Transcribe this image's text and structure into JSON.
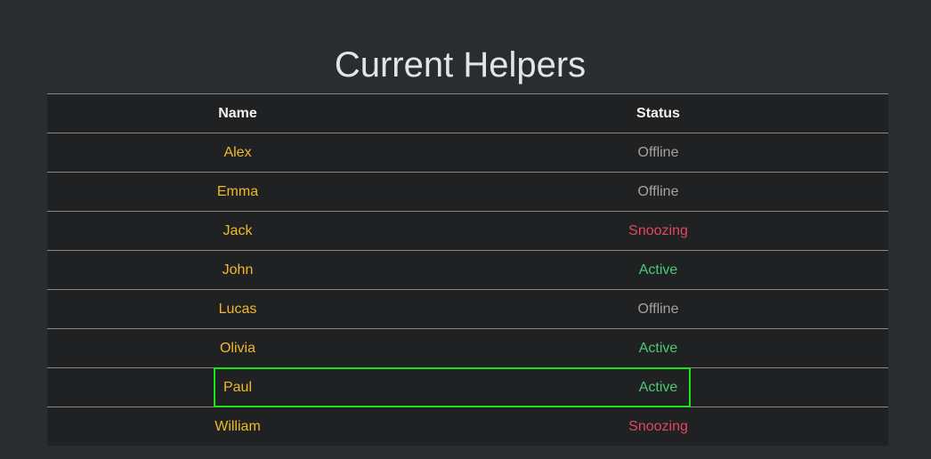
{
  "page": {
    "title": "Current Helpers"
  },
  "table": {
    "headers": {
      "name": "Name",
      "status": "Status"
    },
    "rows": [
      {
        "name": "Alex",
        "status": "Offline",
        "state": "offline"
      },
      {
        "name": "Emma",
        "status": "Offline",
        "state": "offline"
      },
      {
        "name": "Jack",
        "status": "Snoozing",
        "state": "snoozing"
      },
      {
        "name": "John",
        "status": "Active",
        "state": "active"
      },
      {
        "name": "Lucas",
        "status": "Offline",
        "state": "offline"
      },
      {
        "name": "Olivia",
        "status": "Active",
        "state": "active"
      },
      {
        "name": "Paul",
        "status": "Active",
        "state": "active"
      },
      {
        "name": "William",
        "status": "Snoozing",
        "state": "snoozing"
      }
    ]
  },
  "colors": {
    "background": "#2a2d30",
    "table_background": "#1f2123",
    "name": "#f0b92a",
    "offline": "#a3a3a3",
    "snoozing": "#e0485c",
    "active": "#4cc874",
    "highlight": "#19e619"
  }
}
